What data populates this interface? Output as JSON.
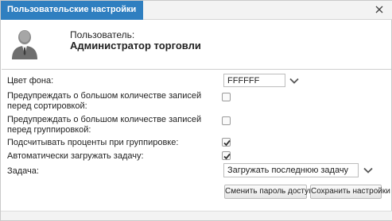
{
  "window": {
    "title": "Пользовательские настройки"
  },
  "user": {
    "label": "Пользователь:",
    "name": "Администратор торговли"
  },
  "settings": {
    "bg_color": {
      "label": "Цвет фона:",
      "value": "FFFFFF"
    },
    "warn_sort": {
      "label": "Предупреждать о большом количестве записей перед сортировкой:",
      "checked": false
    },
    "warn_group": {
      "label": "Предупреждать о большом количестве записей перед группировкой:",
      "checked": false
    },
    "calc_percent": {
      "label": "Подсчитывать проценты при группировке:",
      "checked": true
    },
    "auto_load_task": {
      "label": "Автоматически загружать задачу:",
      "checked": true
    },
    "task": {
      "label": "Задача:",
      "value": "Загружать последнюю задачу"
    }
  },
  "buttons": {
    "change_password": "Сменить пароль доступа",
    "save_settings": "Сохранить настройки"
  },
  "icons": {
    "close": "close-icon",
    "avatar": "user-avatar-icon",
    "dropdown": "chevron-down-icon",
    "check": "checkmark-icon"
  },
  "colors": {
    "title_accent": "#2f7fc0",
    "check": "#333333"
  }
}
